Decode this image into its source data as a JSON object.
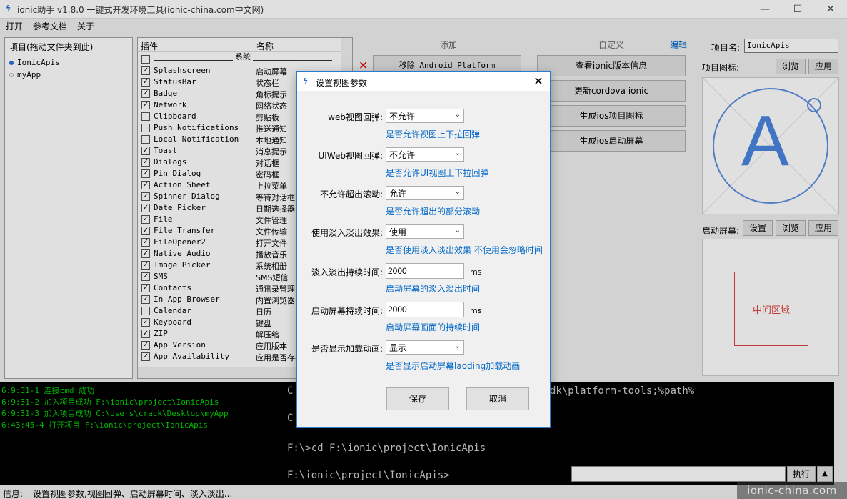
{
  "window": {
    "title": "ionic助手 v1.8.0 一键式开发环境工具(ionic-china.com中文网)"
  },
  "menu": [
    "打开",
    "参考文档",
    "关于"
  ],
  "projects": {
    "header": "项目(拖动文件夹到此)",
    "items": [
      "IonicApis",
      "myApp"
    ]
  },
  "plugins": {
    "col_plugin": "插件",
    "col_name": "名称",
    "group": "系统",
    "rows": [
      {
        "name": "Splashscreen",
        "desc": "启动屏幕",
        "checked": true
      },
      {
        "name": "StatusBar",
        "desc": "状态栏",
        "checked": true
      },
      {
        "name": "Badge",
        "desc": "角标提示",
        "checked": true
      },
      {
        "name": "Network",
        "desc": "网络状态",
        "checked": true
      },
      {
        "name": "Clipboard",
        "desc": "剪贴板",
        "checked": false
      },
      {
        "name": "Push Notifications",
        "desc": "推送通知",
        "checked": false
      },
      {
        "name": "Local Notification",
        "desc": "本地通知",
        "checked": false
      },
      {
        "name": "Toast",
        "desc": "消息提示",
        "checked": true
      },
      {
        "name": "Dialogs",
        "desc": "对话框",
        "checked": true
      },
      {
        "name": "Pin Dialog",
        "desc": "密码框",
        "checked": true
      },
      {
        "name": "Action Sheet",
        "desc": "上拉菜单",
        "checked": true
      },
      {
        "name": "Spinner Dialog",
        "desc": "等待对话框",
        "checked": true
      },
      {
        "name": "Date Picker",
        "desc": "日期选择器",
        "checked": true
      },
      {
        "name": "File",
        "desc": "文件管理",
        "checked": true
      },
      {
        "name": "File Transfer",
        "desc": "文件传输",
        "checked": true
      },
      {
        "name": "FileOpener2",
        "desc": "打开文件",
        "checked": true
      },
      {
        "name": "Native Audio",
        "desc": "播放音乐",
        "checked": true
      },
      {
        "name": "Image Picker",
        "desc": "系统相册",
        "checked": true
      },
      {
        "name": "SMS",
        "desc": "SMS短信",
        "checked": true
      },
      {
        "name": "Contacts",
        "desc": "通讯录管理",
        "checked": true
      },
      {
        "name": "In App Browser",
        "desc": "内置浏览器",
        "checked": true
      },
      {
        "name": "Calendar",
        "desc": "日历",
        "checked": false
      },
      {
        "name": "Keyboard",
        "desc": "键盘",
        "checked": true
      },
      {
        "name": "ZIP",
        "desc": "解压缩",
        "checked": true
      },
      {
        "name": "App Version",
        "desc": "应用版本",
        "checked": true
      },
      {
        "name": "App Availability",
        "desc": "应用是否存在",
        "checked": true
      }
    ]
  },
  "sections": {
    "add": "添加",
    "custom": "自定义",
    "edit": "编辑"
  },
  "actions": {
    "remove_android": "移除 Android Platform",
    "view_ionic": "查看ionic版本信息",
    "update_cordova": "更新cordova ionic",
    "gen_icon": "生成ios项目图标",
    "gen_splash": "生成ios启动屏幕"
  },
  "right": {
    "project_name_label": "项目名:",
    "project_name_value": "IonicApis",
    "project_icon_label": "项目图标:",
    "browse": "浏览",
    "apply": "应用",
    "splash_label": "启动屏幕:",
    "settings": "设置",
    "icon_letter": "A",
    "center_area": "中间区域"
  },
  "log": [
    "6:9:31-1 连接cmd 成功",
    "6:9:31-2 加入项目成功 F:\\ionic\\project\\IonicApis",
    "6:9:31-3 加入项目成功 C:\\Users\\crack\\Desktop\\myApp",
    "6:43:45-4 打开项目 F:\\ionic\\project\\IonicApis"
  ],
  "console": {
    "l1": "C",
    "l1b": "dk\\platform-tools;%path%",
    "l2": "C",
    "l3": "F:\\>cd F:\\ionic\\project\\IonicApis",
    "l4": "F:\\ionic\\project\\IonicApis>",
    "run": "执行",
    "up": "▲"
  },
  "status": {
    "label": "信息:",
    "text": "设置视图参数,视图回弹、启动屏幕时间、淡入淡出..."
  },
  "watermark": "ionic-china.com",
  "dialog": {
    "title": "设置视图参数",
    "fields": [
      {
        "label": "web视图回弹:",
        "value": "不允许",
        "hint": "是否允许视图上下拉回弹"
      },
      {
        "label": "UIWeb视图回弹:",
        "value": "不允许",
        "hint": "是否允许UI视图上下拉回弹"
      },
      {
        "label": "不允许超出滚动:",
        "value": "允许",
        "hint": "是否允许超出的部分滚动"
      },
      {
        "label": "使用淡入淡出效果:",
        "value": "使用",
        "hint": "是否使用淡入淡出效果 不使用会忽略时间"
      },
      {
        "label": "淡入淡出持续时间:",
        "value": "2000",
        "unit": "ms",
        "hint": "启动屏幕的淡入淡出时间"
      },
      {
        "label": "启动屏幕持续时间:",
        "value": "2000",
        "unit": "ms",
        "hint": "启动屏幕画面的持续时间"
      },
      {
        "label": "是否显示加载动画:",
        "value": "显示",
        "hint": "是否显示启动屏幕laoding加载动画"
      }
    ],
    "save": "保存",
    "cancel": "取消"
  },
  "colors": {
    "accent": "#0067c7",
    "border": "#2b78d2",
    "log": "#00d000"
  }
}
